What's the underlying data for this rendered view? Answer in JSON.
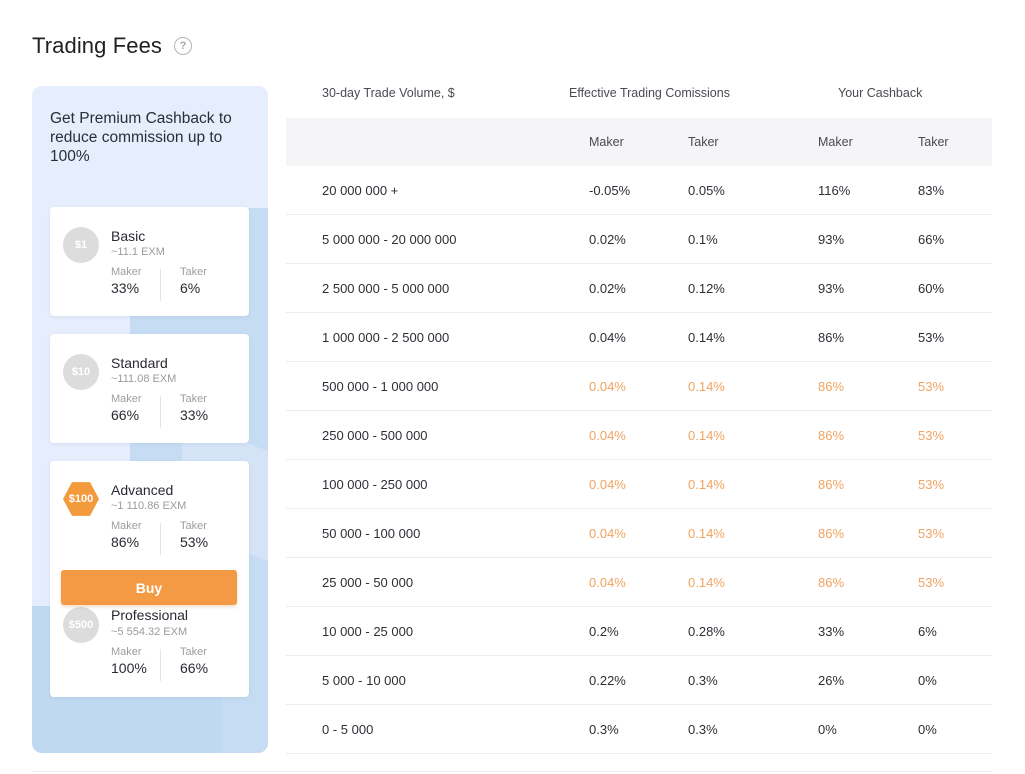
{
  "header": {
    "title": "Trading Fees",
    "help_icon": "question-circle-icon"
  },
  "promo": {
    "headline": "Get Premium Cashback to reduce commission up to 100%",
    "buy_label": "Buy",
    "plans": [
      {
        "name": "Basic",
        "badge": "$1",
        "price": "~11.1 EXM",
        "maker_label": "Maker",
        "maker": "33%",
        "taker_label": "Taker",
        "taker": "6%",
        "active": false
      },
      {
        "name": "Standard",
        "badge": "$10",
        "price": "~111.08 EXM",
        "maker_label": "Maker",
        "maker": "66%",
        "taker_label": "Taker",
        "taker": "33%",
        "active": false
      },
      {
        "name": "Advanced",
        "badge": "$100",
        "price": "~1 110.86 EXM",
        "maker_label": "Maker",
        "maker": "86%",
        "taker_label": "Taker",
        "taker": "53%",
        "active": true
      },
      {
        "name": "Professional",
        "badge": "$500",
        "price": "~5 554.32 EXM",
        "maker_label": "Maker",
        "maker": "100%",
        "taker_label": "Taker",
        "taker": "66%",
        "active": false
      }
    ]
  },
  "table": {
    "group_headers": [
      "30-day Trade Volume, $",
      "Effective Trading Comissions",
      "Your Cashback"
    ],
    "sub_headers": [
      "",
      "Maker",
      "Taker",
      "Maker",
      "Taker"
    ],
    "highlight_color": "#f0a460",
    "rows": [
      {
        "volume": "20 000 000 +",
        "com_maker": "-0.05%",
        "com_taker": "0.05%",
        "cb_maker": "116%",
        "cb_taker": "83%",
        "highlight": false
      },
      {
        "volume": "5 000 000 - 20 000 000",
        "com_maker": "0.02%",
        "com_taker": "0.1%",
        "cb_maker": "93%",
        "cb_taker": "66%",
        "highlight": false
      },
      {
        "volume": "2 500 000 - 5 000 000",
        "com_maker": "0.02%",
        "com_taker": "0.12%",
        "cb_maker": "93%",
        "cb_taker": "60%",
        "highlight": false
      },
      {
        "volume": "1 000 000 - 2 500 000",
        "com_maker": "0.04%",
        "com_taker": "0.14%",
        "cb_maker": "86%",
        "cb_taker": "53%",
        "highlight": false
      },
      {
        "volume": "500 000 - 1 000 000",
        "com_maker": "0.04%",
        "com_taker": "0.14%",
        "cb_maker": "86%",
        "cb_taker": "53%",
        "highlight": true
      },
      {
        "volume": "250 000 - 500 000",
        "com_maker": "0.04%",
        "com_taker": "0.14%",
        "cb_maker": "86%",
        "cb_taker": "53%",
        "highlight": true
      },
      {
        "volume": "100 000 - 250 000",
        "com_maker": "0.04%",
        "com_taker": "0.14%",
        "cb_maker": "86%",
        "cb_taker": "53%",
        "highlight": true
      },
      {
        "volume": "50 000 - 100 000",
        "com_maker": "0.04%",
        "com_taker": "0.14%",
        "cb_maker": "86%",
        "cb_taker": "53%",
        "highlight": true
      },
      {
        "volume": "25 000 - 50 000",
        "com_maker": "0.04%",
        "com_taker": "0.14%",
        "cb_maker": "86%",
        "cb_taker": "53%",
        "highlight": true
      },
      {
        "volume": "10 000 - 25 000",
        "com_maker": "0.2%",
        "com_taker": "0.28%",
        "cb_maker": "33%",
        "cb_taker": "6%",
        "highlight": false
      },
      {
        "volume": "5 000 - 10 000",
        "com_maker": "0.22%",
        "com_taker": "0.3%",
        "cb_maker": "26%",
        "cb_taker": "0%",
        "highlight": false
      },
      {
        "volume": "0 - 5 000",
        "com_maker": "0.3%",
        "com_taker": "0.3%",
        "cb_maker": "0%",
        "cb_taker": "0%",
        "highlight": false
      }
    ]
  }
}
